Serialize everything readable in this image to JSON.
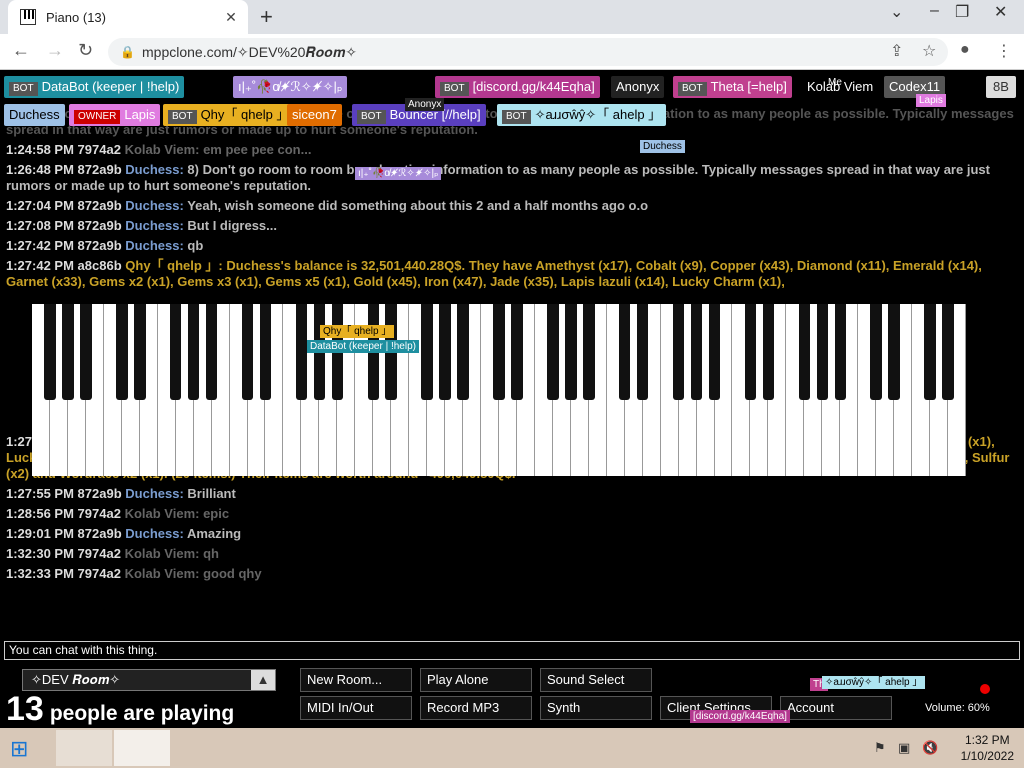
{
  "browser": {
    "tab_title": "Piano (13)",
    "url": "mppclone.com/✧DEV%20𝑹𝒐𝒐𝒎✧"
  },
  "users": [
    {
      "badge": "BOT",
      "name": "DataBot (keeper | !help)",
      "color": "#1e8fa0"
    },
    {
      "badge": "",
      "name": "ı|₊˚🥀ɑ̸✦̸ℛ✧✦̸✧|ₚ",
      "color": "#a78bda"
    },
    {
      "badge": "BOT",
      "name": "[discord.gg/k44Eqha]",
      "color": "#b3388f"
    },
    {
      "badge": "",
      "name": "Anonyx",
      "color": "#222"
    },
    {
      "badge": "BOT",
      "name": "Theta [=help]",
      "color": "#c0408f"
    },
    {
      "badge": "",
      "name": "Kolab Viem",
      "color": "#000"
    },
    {
      "badge": "",
      "name": "Codex11",
      "color": "#555"
    },
    {
      "badge": "",
      "name": "Duchess",
      "color": "#9ec1e6"
    },
    {
      "badge": "OWNER",
      "name": "Lapis",
      "color": "#e07be0"
    },
    {
      "badge": "BOT",
      "name": "Qhy「 qhelp 」",
      "color": "#e8b021"
    },
    {
      "badge": "",
      "name": "siceon7",
      "color": "#e06c00"
    },
    {
      "badge": "BOT",
      "name": "Bouncer [//help]",
      "color": "#5a3fbf"
    },
    {
      "badge": "BOT",
      "name": "✧аɹɹσŵŷ✧「 ahelp 」",
      "color": "#aee4f0"
    }
  ],
  "corner_badge": "8B",
  "chat": {
    "header_faded": "bans will occur for you if you're caught doing any type of it! 8) Don't go room to room broadcasting information to as many people as possible. Typically messages spread in that way are just rumors or made up to hurt someone's reputation.",
    "messages": [
      {
        "time": "1:24:58 PM",
        "id": "7974a2",
        "name": "Kolab Viem:",
        "text": "em pee pee con...",
        "style": "dim"
      },
      {
        "time": "1:26:48 PM",
        "id": "872a9b",
        "name": "Duchess:",
        "text": "8) Don't go room to room broadcasting information to as many people as possible. Typically messages spread in that way are just rumors or made up to hurt someone's reputation.",
        "style": ""
      },
      {
        "time": "1:27:04 PM",
        "id": "872a9b",
        "name": "Duchess:",
        "text": "Yeah, wish someone did something about this 2 and a half months ago o.o",
        "style": ""
      },
      {
        "time": "1:27:08 PM",
        "id": "872a9b",
        "name": "Duchess:",
        "text": "But I digress...",
        "style": ""
      },
      {
        "time": "1:27:42 PM",
        "id": "872a9b",
        "name": "Duchess:",
        "text": "qb",
        "style": ""
      },
      {
        "time": "1:27:42 PM",
        "id": "a8c86b",
        "name": "Qhy「 qhelp 」:",
        "text": "Duchess's balance is 32,501,440.28Q$. They have Amethyst (x17), Cobalt (x9), Copper (x43), Diamond (x11), Emerald (x14), Garnet (x33), Gems x2 (x1), Gems x3 (x1), Gems x5 (x1), Gold (x45), Iron (x47), Jade (x35), Lapis lazuli (x14), Lucky Charm (x1),",
        "style": "gold"
      }
    ],
    "messages_after": [
      {
        "time": "1:27:52 PM",
        "id": "a8c86b",
        "name": "Qhy「 qhelp 」:",
        "text": "Duchess's balance is 33,347,040.09Q$. They have Garnet (x1), Gems x2 (x1), Gems x3 (x1), Gems x5 (x1), Iron (x1), Jade (x1), Lucky Charm (x1), Mathrace x2 (x1), Meteorite (x1), Meteorite Pickaxe (x1), Mine Speed x2 (x1), Mine x2 (x1), Mine x3 (x1), Mine x5 (x1), Ruby (x1), Silver (x2), Sulfur (x2) and Wordrace x2 (x1). (20 items.) Their items are worth around ~496,649.80Q$.",
        "style": "gold"
      },
      {
        "time": "1:27:55 PM",
        "id": "872a9b",
        "name": "Duchess:",
        "text": "Brilliant",
        "style": ""
      },
      {
        "time": "1:28:56 PM",
        "id": "7974a2",
        "name": "Kolab Viem:",
        "text": "epic",
        "style": "dim"
      },
      {
        "time": "1:29:01 PM",
        "id": "872a9b",
        "name": "Duchess:",
        "text": "Amazing",
        "style": ""
      },
      {
        "time": "1:32:30 PM",
        "id": "7974a2",
        "name": "Kolab Viem:",
        "text": "qh",
        "style": "dim"
      },
      {
        "time": "1:32:33 PM",
        "id": "7974a2",
        "name": "Kolab Viem:",
        "text": "good qhy",
        "style": "dim"
      }
    ]
  },
  "floating": {
    "qhy": "Qhy「 qhelp 」",
    "databot": "DataBot (keeper | !help)",
    "duchess": "Duchess",
    "anonyx": "Anonyx",
    "lapis": "Lapis",
    "discord": "[discord.gg/k44Eqha]",
    "arrowy": "✧аɹɹσŵŷ✧「 ahelp 」",
    "me": "Me",
    "theta_short": "Th"
  },
  "input_placeholder": "You can chat with this thing.",
  "room_name": "✧DEV 𝑹𝒐𝒐𝒎✧",
  "player_count": "13",
  "player_label": "people are playing",
  "buttons": {
    "new_room": "New Room...",
    "play_alone": "Play Alone",
    "sound_select": "Sound Select",
    "midi": "MIDI In/Out",
    "record": "Record MP3",
    "synth": "Synth",
    "client_settings": "Client Settings",
    "account": "Account"
  },
  "volume_label": "Volume: 60%",
  "taskbar": {
    "time": "1:32 PM",
    "date": "1/10/2022"
  }
}
